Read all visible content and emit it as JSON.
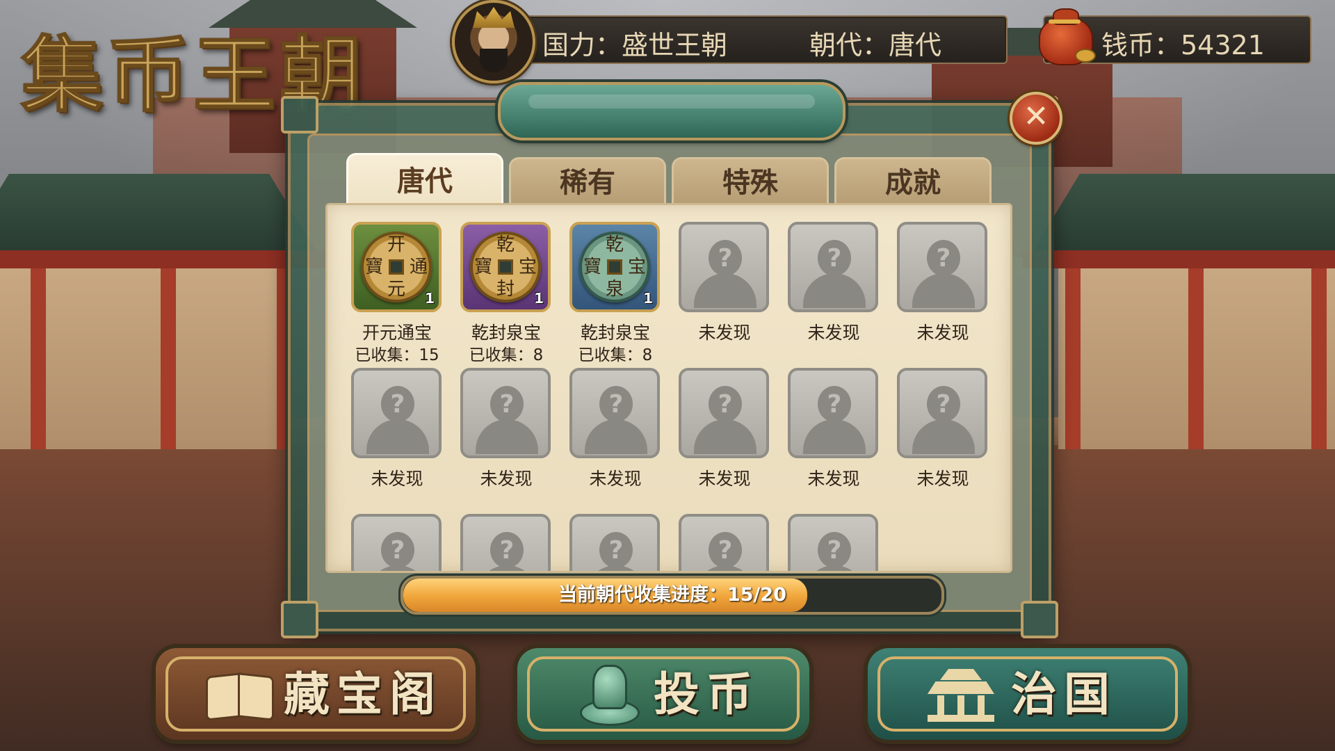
{
  "game": {
    "title": "集币王朝"
  },
  "status": {
    "power_label": "国力：盛世王朝",
    "dynasty_label": "朝代：唐代",
    "coins_label": "钱币：54321"
  },
  "dialog": {
    "tabs": [
      {
        "label": "唐代",
        "active": true
      },
      {
        "label": "稀有",
        "active": false
      },
      {
        "label": "特殊",
        "active": false
      },
      {
        "label": "成就",
        "active": false
      }
    ],
    "close_symbol": "✕",
    "coins": [
      {
        "name": "开元通宝",
        "sub": "已收集：15",
        "frame": "green",
        "count": "1",
        "glyphs": {
          "top": "开",
          "bottom": "元",
          "left": "寶",
          "right": "通"
        }
      },
      {
        "name": "乾封泉宝",
        "sub": "已收集：8",
        "frame": "purple",
        "count": "1",
        "glyphs": {
          "top": "乾",
          "bottom": "封",
          "left": "寶",
          "right": "宝"
        }
      },
      {
        "name": "乾封泉宝",
        "sub": "已收集：8",
        "frame": "blue",
        "count": "1",
        "glyphs": {
          "top": "乾",
          "bottom": "泉",
          "left": "寶",
          "right": "宝"
        }
      },
      {
        "name": "未发现"
      },
      {
        "name": "未发现"
      },
      {
        "name": "未发现"
      },
      {
        "name": "未发现"
      },
      {
        "name": "未发现"
      },
      {
        "name": "未发现"
      },
      {
        "name": "未发现"
      },
      {
        "name": "未发现"
      },
      {
        "name": "未发现"
      },
      {
        "name": ""
      },
      {
        "name": ""
      },
      {
        "name": ""
      },
      {
        "name": ""
      },
      {
        "name": ""
      }
    ],
    "locked_symbol": "?",
    "progress": {
      "label": "当前朝代收集进度：15/20",
      "collected": 15,
      "total": 20
    }
  },
  "bottom_buttons": [
    {
      "label": "藏宝阁",
      "icon": "book-icon"
    },
    {
      "label": "投币",
      "icon": "seal-icon"
    },
    {
      "label": "治国",
      "icon": "palace-icon"
    }
  ]
}
